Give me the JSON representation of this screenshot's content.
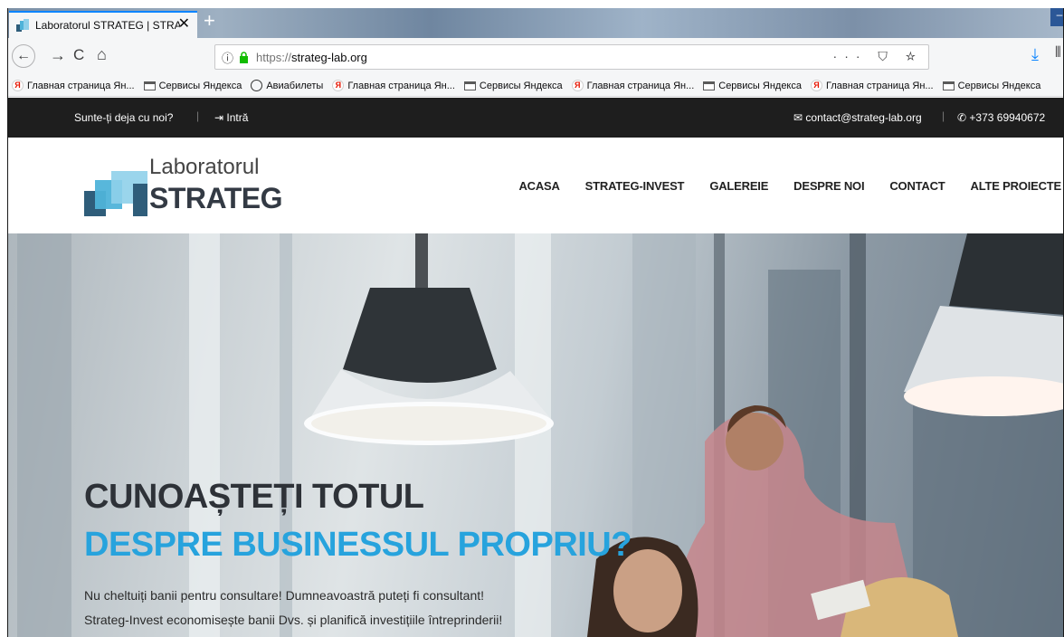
{
  "browser": {
    "tab_title": "Laboratorul STRATEG | STRATE",
    "tab_close": "✕",
    "new_tab": "+",
    "url_prefix": "https://",
    "url_host": "strateg-lab.org",
    "url_actions": "··· ⛉ ☆"
  },
  "bookmarks": [
    {
      "icon": "yandex-icon",
      "label": "Главная страница Ян..."
    },
    {
      "icon": "folder-icon",
      "label": "Сервисы Яндекса"
    },
    {
      "icon": "globe-icon",
      "label": "Авиабилеты"
    },
    {
      "icon": "yandex-icon",
      "label": "Главная страница Ян..."
    },
    {
      "icon": "folder-icon",
      "label": "Сервисы Яндекса"
    },
    {
      "icon": "yandex-icon",
      "label": "Главная страница Ян..."
    },
    {
      "icon": "folder-icon",
      "label": "Сервисы Яндекса"
    },
    {
      "icon": "yandex-icon",
      "label": "Главная страница Ян..."
    },
    {
      "icon": "folder-icon",
      "label": "Сервисы Яндекса"
    }
  ],
  "topbar": {
    "ask": "Sunte-ți deja cu noi?",
    "separator": "|",
    "login": "Intră",
    "email": "contact@strateg-lab.org",
    "phone": "+373 69940672"
  },
  "logo": {
    "line1": "Laboratorul",
    "line2": "STRATEG"
  },
  "nav": [
    "ACASA",
    "STRATEG-INVEST",
    "GALEREIE",
    "DESPRE NOI",
    "CONTACT",
    "ALTE PROIECTE"
  ],
  "hero": {
    "title1": "CUNOAȘTEȚI TOTUL",
    "title2": "DESPRE BUSINESSUL PROPRIU?",
    "line1": "Nu cheltuiți banii pentru consultare! Dumneavoastră puteți fi consultant!",
    "line2": "Strateg-Invest economisește banii Dvs. și planifică investițiile întreprinderii!"
  },
  "colors": {
    "accent": "#27a3dd",
    "topbar_bg": "#1e1e1e",
    "logo_dark": "#2f5d7a",
    "logo_light": "#4fb3d9"
  }
}
